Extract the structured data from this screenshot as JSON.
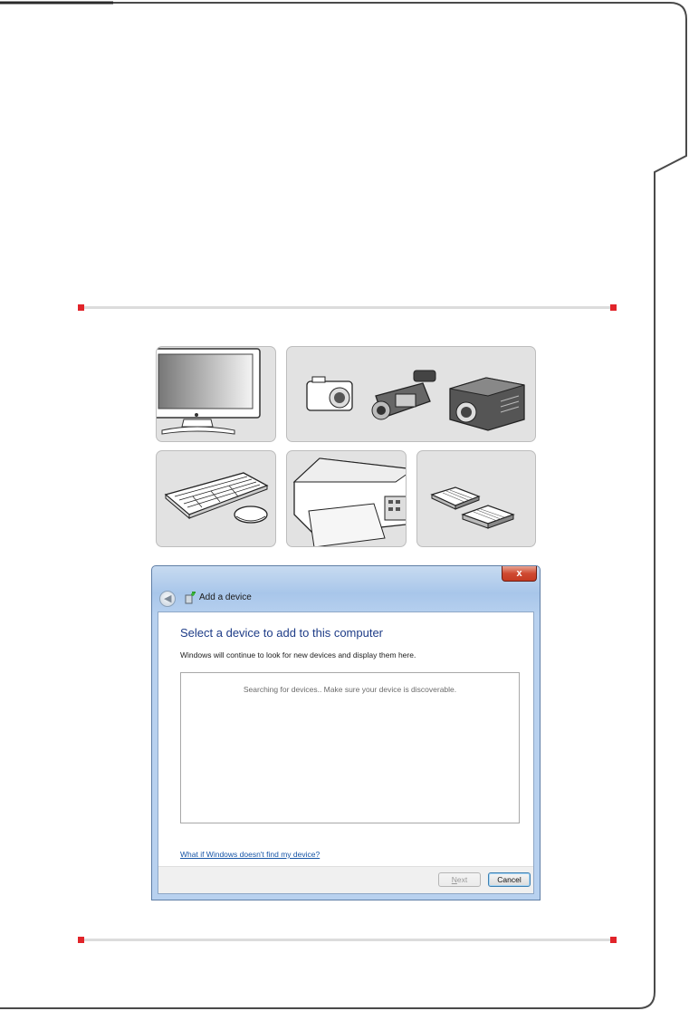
{
  "colors": {
    "accent_red": "#e1242a",
    "frame_line": "#4a4a4a",
    "rule_gray": "#dcdcdc",
    "tile_bg": "#e2e2e2",
    "dialog_heading": "#1e3c87",
    "link_blue": "#1554a6"
  },
  "device_tiles": [
    {
      "icon": "monitor-icon"
    },
    {
      "icon": "camera-camcorder-projector-icon"
    },
    {
      "icon": "keyboard-mouse-icon"
    },
    {
      "icon": "printer-icon"
    },
    {
      "icon": "storage-drives-icon"
    }
  ],
  "dialog": {
    "close_label": "x",
    "back_icon": "back-arrow-icon",
    "title_icon": "add-device-icon",
    "title": "Add a device",
    "heading": "Select a device to add to this computer",
    "subtext": "Windows will continue to look for new devices and display them here.",
    "searching_text": "Searching for devices..  Make sure your device is discoverable.",
    "help_link": "What if Windows doesn't find my device?",
    "next_underlined": "N",
    "next_rest": "ext",
    "cancel_label": "Cancel"
  }
}
